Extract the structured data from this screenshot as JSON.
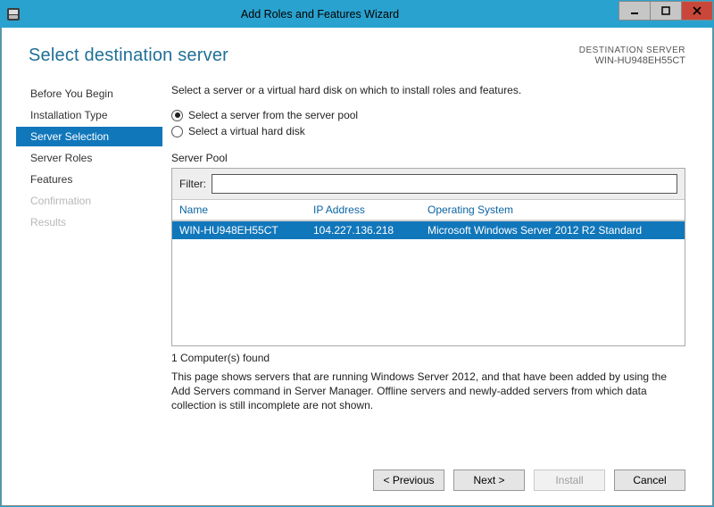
{
  "window": {
    "title": "Add Roles and Features Wizard"
  },
  "page": {
    "title": "Select destination server",
    "dest_label": "DESTINATION SERVER",
    "dest_value": "WIN-HU948EH55CT"
  },
  "sidebar": {
    "items": [
      {
        "label": "Before You Begin",
        "state": "normal"
      },
      {
        "label": "Installation Type",
        "state": "normal"
      },
      {
        "label": "Server Selection",
        "state": "active"
      },
      {
        "label": "Server Roles",
        "state": "normal"
      },
      {
        "label": "Features",
        "state": "normal"
      },
      {
        "label": "Confirmation",
        "state": "disabled"
      },
      {
        "label": "Results",
        "state": "disabled"
      }
    ]
  },
  "main": {
    "intro": "Select a server or a virtual hard disk on which to install roles and features.",
    "radios": [
      {
        "label": "Select a server from the server pool",
        "checked": true
      },
      {
        "label": "Select a virtual hard disk",
        "checked": false
      }
    ],
    "pool_label": "Server Pool",
    "filter_label": "Filter:",
    "filter_value": "",
    "columns": {
      "name": "Name",
      "ip": "IP Address",
      "os": "Operating System"
    },
    "servers": [
      {
        "name": "WIN-HU948EH55CT",
        "ip": "104.227.136.218",
        "os": "Microsoft Windows Server 2012 R2 Standard"
      }
    ],
    "found_text": "1 Computer(s) found",
    "note": "This page shows servers that are running Windows Server 2012, and that have been added by using the Add Servers command in Server Manager. Offline servers and newly-added servers from which data collection is still incomplete are not shown."
  },
  "footer": {
    "previous": "< Previous",
    "next": "Next >",
    "install": "Install",
    "cancel": "Cancel"
  }
}
